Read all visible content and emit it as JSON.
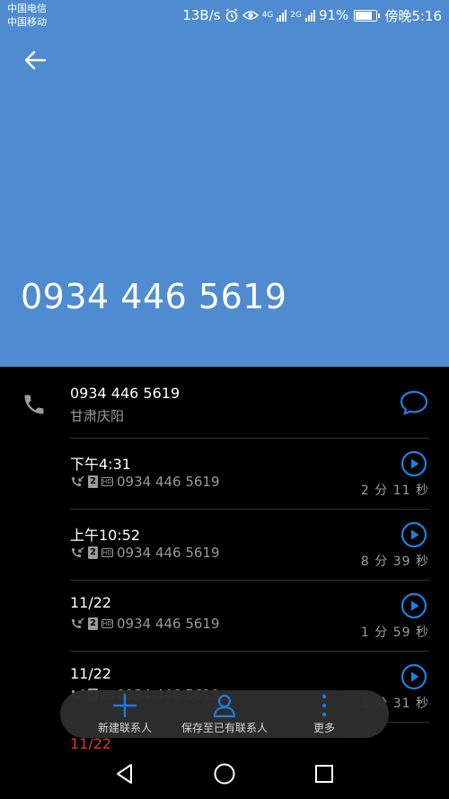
{
  "status": {
    "carrier1": "中国电信",
    "carrier2": "中国移动",
    "speed": "13B/s",
    "net1": "4G",
    "net2": "2G",
    "battery": "91%",
    "battery_level": 0.91,
    "time": "傍晚5:16"
  },
  "header": {
    "number": "0934 446 5619",
    "color": "#4f8bd0"
  },
  "contact": {
    "number": "0934 446 5619",
    "location": "甘肃庆阳"
  },
  "calls": [
    {
      "time": "下午4:31",
      "sim": "2",
      "number": "0934 446 5619",
      "duration": "2 分 11 秒"
    },
    {
      "time": "上午10:52",
      "sim": "2",
      "number": "0934 446 5619",
      "duration": "8 分 39 秒"
    },
    {
      "time": "11/22",
      "sim": "2",
      "number": "0934 446 5619",
      "duration": "1 分 59 秒"
    },
    {
      "time": "11/22",
      "sim": "2",
      "number": "0934 446 5619",
      "duration": "1 分 31 秒"
    }
  ],
  "partial_date": "11/22",
  "actions": {
    "new_contact": "新建联系人",
    "save_existing": "保存至已有联系人",
    "more": "更多"
  },
  "accent": "#1f7fe0",
  "missed_color": "#e3342f"
}
